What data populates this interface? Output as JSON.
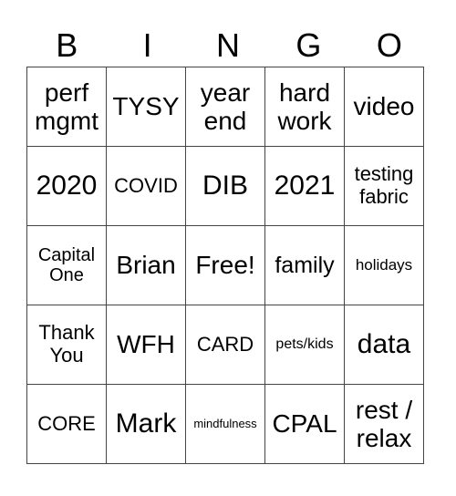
{
  "header": [
    "B",
    "I",
    "N",
    "G",
    "O"
  ],
  "rows": [
    [
      {
        "text": "perf mgmt",
        "size": 28
      },
      {
        "text": "TYSY",
        "size": 28
      },
      {
        "text": "year end",
        "size": 28
      },
      {
        "text": "hard work",
        "size": 28
      },
      {
        "text": "video",
        "size": 28
      }
    ],
    [
      {
        "text": "2020",
        "size": 30
      },
      {
        "text": "COVID",
        "size": 22
      },
      {
        "text": "DIB",
        "size": 30
      },
      {
        "text": "2021",
        "size": 30
      },
      {
        "text": "testing fabric",
        "size": 22
      }
    ],
    [
      {
        "text": "Capital One",
        "size": 20
      },
      {
        "text": "Brian",
        "size": 28
      },
      {
        "text": "Free!",
        "size": 28
      },
      {
        "text": "family",
        "size": 25
      },
      {
        "text": "holidays",
        "size": 17
      }
    ],
    [
      {
        "text": "Thank You",
        "size": 22
      },
      {
        "text": "WFH",
        "size": 28
      },
      {
        "text": "CARD",
        "size": 22
      },
      {
        "text": "pets/kids",
        "size": 16
      },
      {
        "text": "data",
        "size": 30
      }
    ],
    [
      {
        "text": "CORE",
        "size": 22
      },
      {
        "text": "Mark",
        "size": 30
      },
      {
        "text": "mindfulness",
        "size": 13
      },
      {
        "text": "CPAL",
        "size": 28
      },
      {
        "text": "rest / relax",
        "size": 28
      }
    ]
  ]
}
